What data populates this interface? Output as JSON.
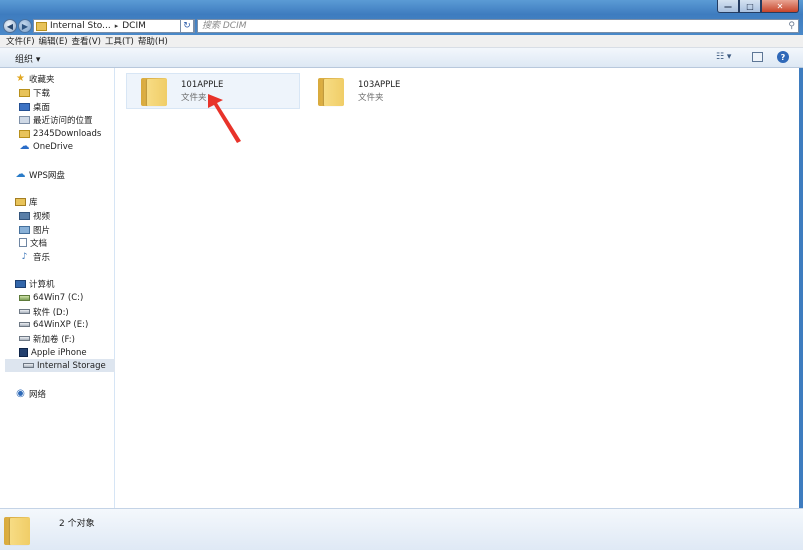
{
  "window": {
    "minimize_glyph": "—",
    "maximize_glyph": "□",
    "close_glyph": "✕"
  },
  "address": {
    "crumbs": [
      "Internal Sto...",
      "DCIM"
    ],
    "separator": "▸"
  },
  "search": {
    "placeholder": "搜索 DCIM",
    "icon": "search-icon"
  },
  "menu": [
    "文件(F)",
    "编辑(E)",
    "查看(V)",
    "工具(T)",
    "帮助(H)"
  ],
  "toolbar": {
    "organize_label": "组织 ▾",
    "view_glyph": "☷ ▾",
    "help_glyph": "?"
  },
  "nav": {
    "favorites": {
      "label": "收藏夹",
      "items": [
        "下载",
        "桌面",
        "最近访问的位置",
        "2345Downloads",
        "OneDrive"
      ]
    },
    "wps": {
      "label": "WPS网盘"
    },
    "library": {
      "label": "库",
      "items": [
        "视频",
        "图片",
        "文档",
        "音乐"
      ]
    },
    "computer": {
      "label": "计算机",
      "items": [
        "64Win7  (C:)",
        "软件 (D:)",
        "64WinXP  (E:)",
        "新加卷 (F:)",
        "Apple iPhone",
        "Internal Storage"
      ]
    },
    "network": {
      "label": "网络"
    }
  },
  "files": [
    {
      "name": "101APPLE",
      "type": "文件夹",
      "selected": true
    },
    {
      "name": "103APPLE",
      "type": "文件夹",
      "selected": false
    }
  ],
  "status": {
    "count": "2 个对象"
  },
  "colors": {
    "titlebar": "#4a89c9",
    "annotation_arrow": "#e8332a"
  }
}
